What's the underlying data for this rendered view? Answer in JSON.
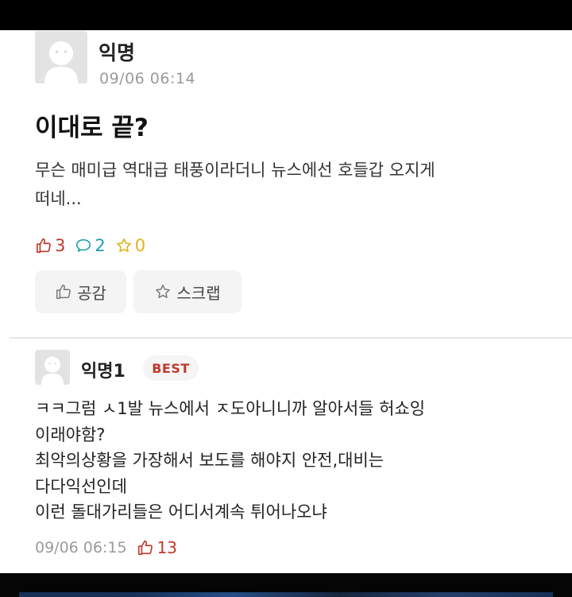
{
  "post": {
    "author": "익명",
    "time": "09/06 06:14",
    "title": "이대로 끝?",
    "body": "무슨 매미급 역대급 태풍이라더니 뉴스에선 호들갑 오지게\n떠네...",
    "stats": {
      "likes": "3",
      "comments": "2",
      "scraps": "0"
    }
  },
  "buttons": {
    "like_label": "공감",
    "scrap_label": "스크랩"
  },
  "comment": {
    "author": "익명1",
    "badge": "BEST",
    "body": "ㅋㅋ그럼 ㅅ1발 뉴스에서 ㅈ도아니니까 알아서들 허쇼잉\n이래야함?\n최악의상황을 가장해서 보도를 해야지 안전,대비는\n다다익선인데\n이런 돌대가리들은 어디서계속 튀어나오냐",
    "time": "09/06 06:15",
    "likes": "13"
  },
  "colors": {
    "like": "#c0392b",
    "comment": "#1ba1b4",
    "scrap": "#e0b21a",
    "muted": "#9a9a9a"
  },
  "icons": [
    "avatar-placeholder-icon",
    "thumbs-up-icon",
    "speech-bubble-icon",
    "star-icon"
  ]
}
